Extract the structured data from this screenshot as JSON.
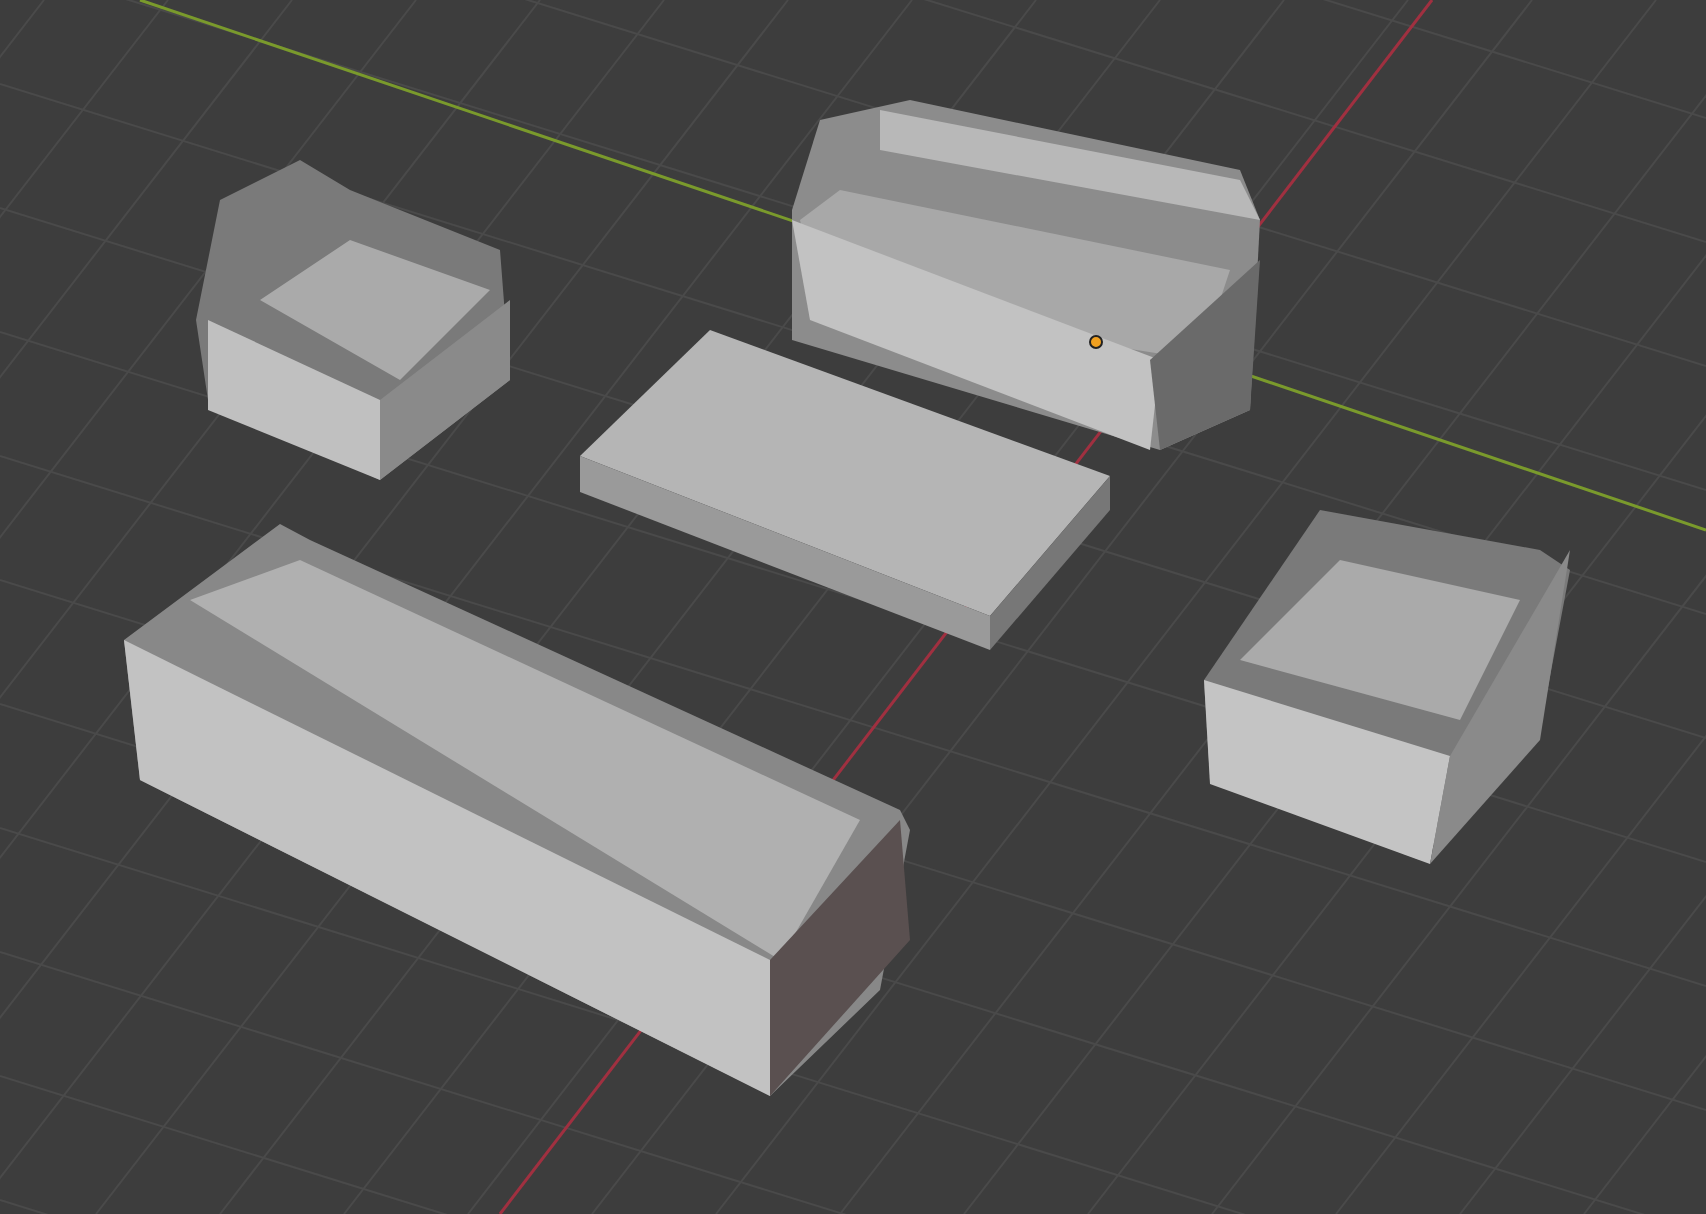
{
  "viewport": {
    "grid_visible": true,
    "axes_visible": true,
    "origin_visible": true
  }
}
